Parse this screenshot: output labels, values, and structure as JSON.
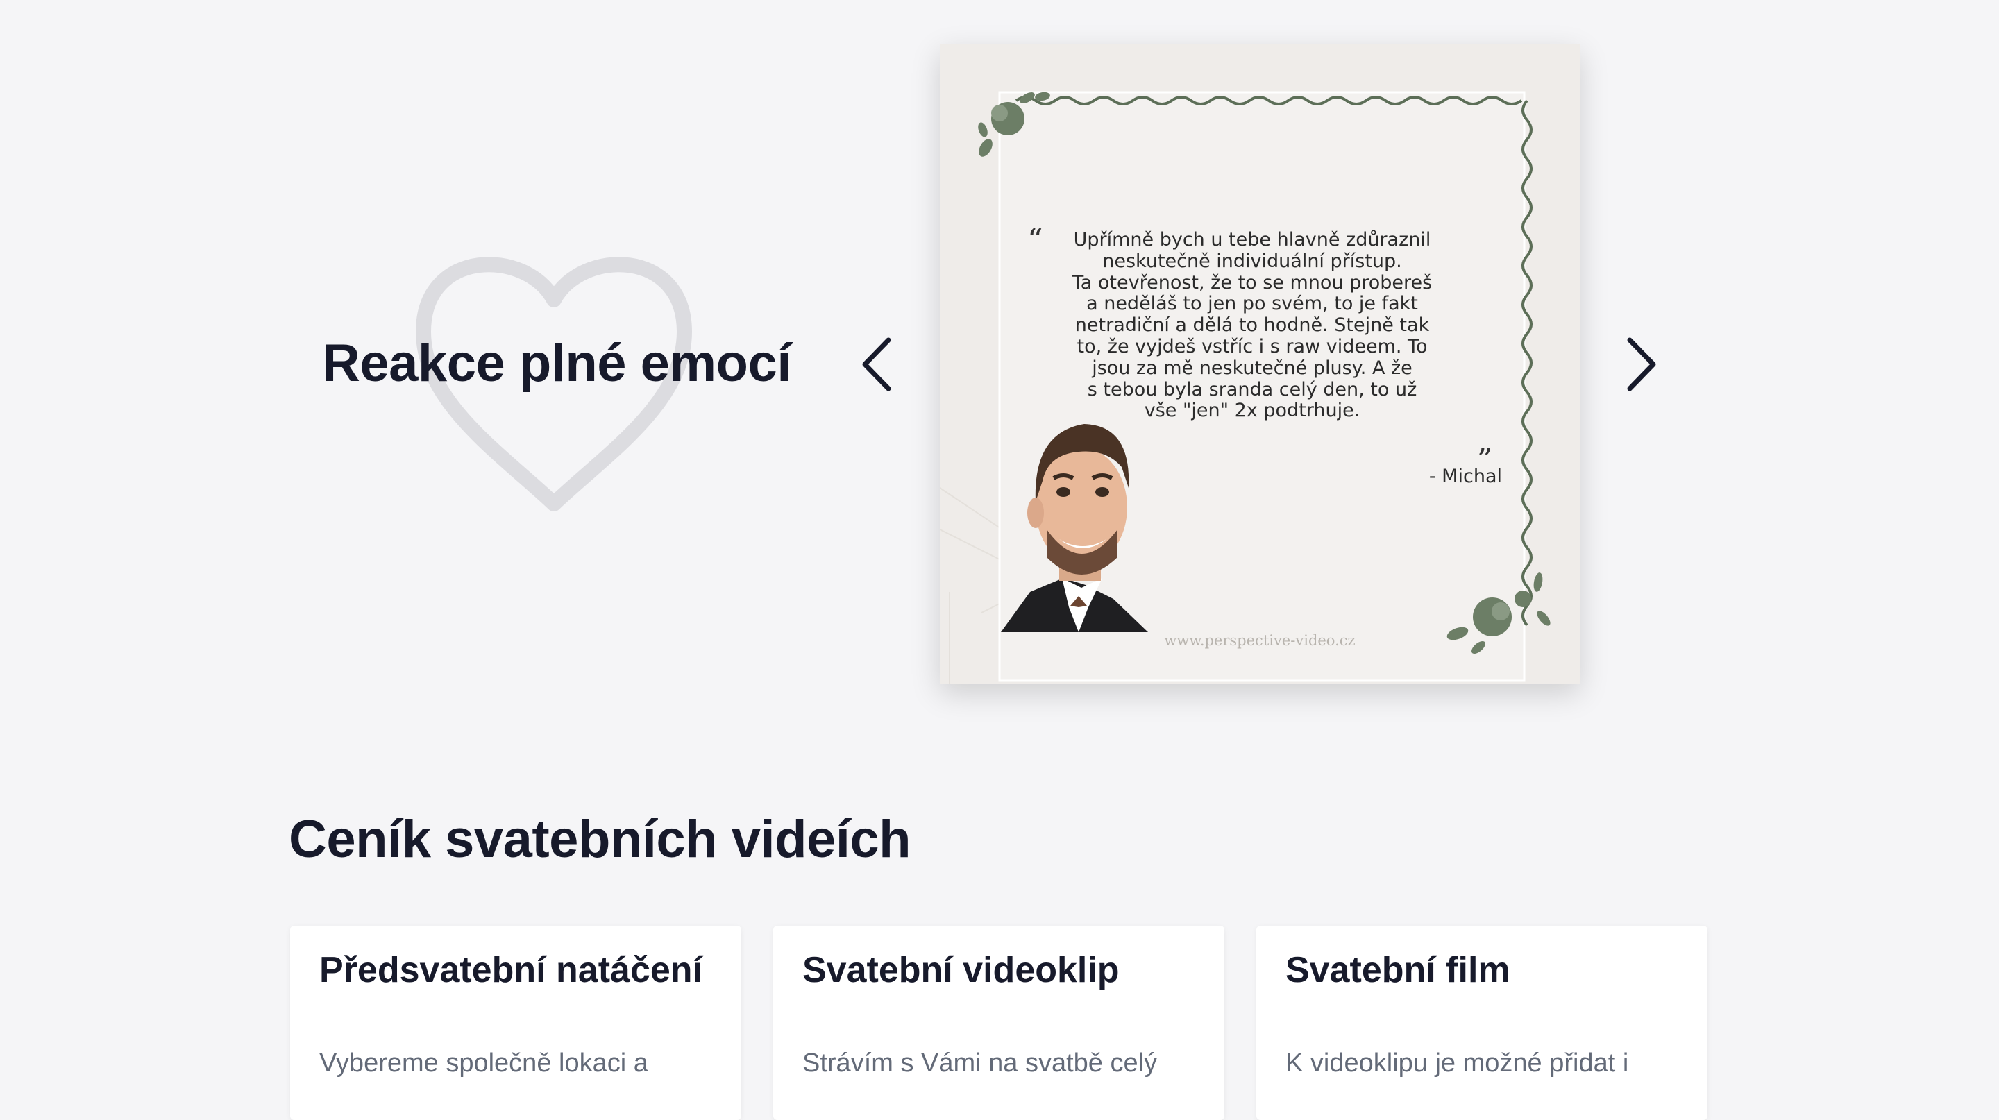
{
  "reviews": {
    "title": "Reakce plné emocí",
    "quote": "Upřímně bych u tebe hlavně zdůraznil\nneskutečně individuální přístup.\nTa otevřenost, že to se mnou probereš\na neděláš to jen po svém, to je fakt\nnetradiční a dělá to hodně. Stejně tak\nto, že vyjdeš vstříc i s raw videem. To\njsou za mě neskutečné plusy. A že\ns tebou byla sranda celý den, to už\nvše \"jen\" 2x podtrhuje.",
    "quote_open": "“",
    "quote_close": "”",
    "author": "- Michal",
    "watermark": "www.perspective-video.cz"
  },
  "pricing": {
    "title": "Ceník svatebních videích",
    "cards": [
      {
        "title": "Předsvatební natáčení",
        "text": "Vybereme společně lokaci a"
      },
      {
        "title": "Svatební videoklip",
        "text": "Strávím s Vámi na svatbě celý"
      },
      {
        "title": "Svatební film",
        "text": "K videoklipu je možné přidat i"
      }
    ]
  },
  "colors": {
    "background": "#f5f5f7",
    "heading": "#171a2b",
    "body_text": "#636a78",
    "vine_green": "#5c6e57",
    "heart_outline": "#dcdce0"
  },
  "icons": {
    "prev": "chevron-left-icon",
    "next": "chevron-right-icon",
    "decoration": "heart-outline-icon"
  }
}
